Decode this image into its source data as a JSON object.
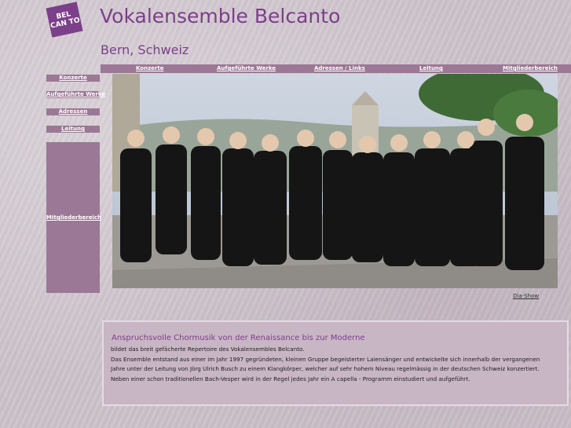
{
  "logo": {
    "text": "BEL CAN TO"
  },
  "header": {
    "title": "Vokalensemble Belcanto",
    "subtitle": "Bern, Schweiz"
  },
  "topnav": {
    "items": [
      {
        "label": "Konzerte"
      },
      {
        "label": "Aufgeführte Werke"
      },
      {
        "label": "Adressen / Links"
      },
      {
        "label": "Leitung"
      },
      {
        "label": "Mitgliederbereich"
      }
    ]
  },
  "sidebar": {
    "items": [
      {
        "label": "Konzerte"
      },
      {
        "label": "Aufgeführte Werke"
      },
      {
        "label": "Adressen"
      },
      {
        "label": "Leitung"
      }
    ],
    "member_label": "Mitgliederbereich"
  },
  "photo": {
    "slideshow_link": "Dia-Show"
  },
  "content": {
    "heading": "Anspruchsvolle Chormusik von der Renaissance bis zur Moderne",
    "lines": [
      "bildet das breit gefächerte Repertoire des Vokalensembles Belcanto.",
      "Das Ensemble entstand aus einer im Jahr 1997 gegründeten, kleinen Gruppe begeisterter Laiensänger und entwickelte sich innerhalb der vergangenen",
      "Jahre unter der Leitung von Jörg Ulrich Busch zu einem Klangkörper, welcher auf sehr hohem Niveau regelmässig in der deutschen Schweiz konzertiert.",
      "Neben einer schon traditionellen Bach-Vesper wird in der Regel jedes Jahr ein A capella - Programm einstudiert und aufgeführt."
    ]
  },
  "colors": {
    "accent": "#7c3f8a",
    "nav_background": "#9b7895",
    "page_background": "#cdc4cb"
  }
}
